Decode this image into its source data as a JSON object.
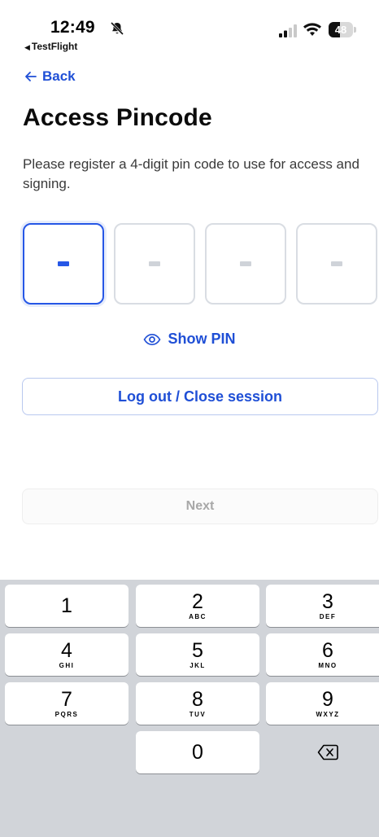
{
  "status_bar": {
    "time": "12:49",
    "back_app": "TestFlight",
    "battery": "48",
    "battery_level": 0.48
  },
  "nav": {
    "back_label": "Back"
  },
  "header": {
    "title": "Access Pincode",
    "description": "Please register a 4-digit pin code to use for access and signing."
  },
  "pin": {
    "digits": [
      "-",
      "-",
      "-",
      "-"
    ],
    "active_index": 0
  },
  "show_pin_label": "Show PIN",
  "logout_label": "Log out / Close session",
  "next_label": "Next",
  "keypad": {
    "keys": [
      {
        "num": "1",
        "letters": ""
      },
      {
        "num": "2",
        "letters": "ABC"
      },
      {
        "num": "3",
        "letters": "DEF"
      },
      {
        "num": "4",
        "letters": "GHI"
      },
      {
        "num": "5",
        "letters": "JKL"
      },
      {
        "num": "6",
        "letters": "MNO"
      },
      {
        "num": "7",
        "letters": "PQRS"
      },
      {
        "num": "8",
        "letters": "TUV"
      },
      {
        "num": "9",
        "letters": "WXYZ"
      },
      {
        "num": "0",
        "letters": ""
      }
    ]
  },
  "colors": {
    "accent": "#1f4fd6",
    "keypad_bg": "#d1d4d9",
    "disabled_text": "#a8a8a8"
  }
}
